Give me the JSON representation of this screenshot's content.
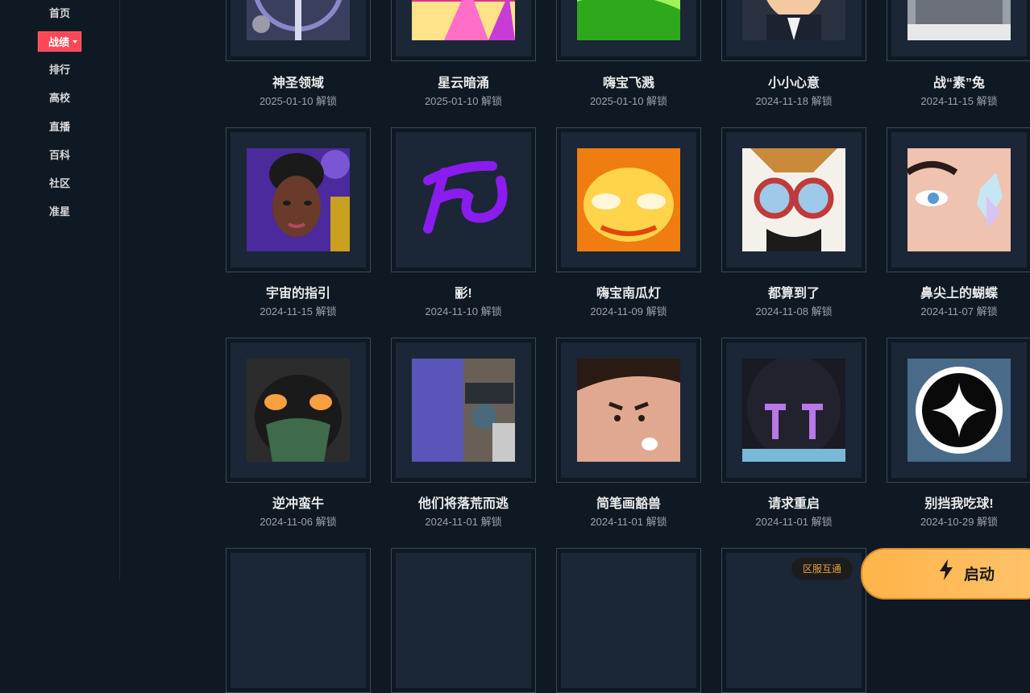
{
  "sidebar": {
    "items": [
      {
        "label": "首页"
      },
      {
        "label": "战绩",
        "active": true
      },
      {
        "label": "排行"
      },
      {
        "label": "高校"
      },
      {
        "label": "直播"
      },
      {
        "label": "百科"
      },
      {
        "label": "社区"
      },
      {
        "label": "准星"
      }
    ]
  },
  "cards": [
    {
      "title": "神圣领域",
      "date": "2025-01-10 解锁",
      "icon": "sacred-domain-art"
    },
    {
      "title": "星云暗涌",
      "date": "2025-01-10 解锁",
      "icon": "nebula-art"
    },
    {
      "title": "嗨宝飞溅",
      "date": "2025-01-10 解锁",
      "icon": "splash-art"
    },
    {
      "title": "小小心意",
      "date": "2024-11-18 解锁",
      "icon": "gentleman-art"
    },
    {
      "title": "战“素”兔",
      "date": "2024-11-15 解锁",
      "icon": "pixel-rabbit-art"
    },
    {
      "title": "宇宙的指引",
      "date": "2024-11-15 解锁",
      "icon": "astra-portrait-art"
    },
    {
      "title": "彨!",
      "date": "2024-11-10 解锁",
      "icon": "purple-calligraphy-art"
    },
    {
      "title": "嗨宝南瓜灯",
      "date": "2024-11-09 解锁",
      "icon": "pumpkin-lantern-art"
    },
    {
      "title": "都算到了",
      "date": "2024-11-08 解锁",
      "icon": "goggles-cat-art"
    },
    {
      "title": "鼻尖上的蝴蝶",
      "date": "2024-11-07 解锁",
      "icon": "butterfly-nose-art"
    },
    {
      "title": "逆冲蛮牛",
      "date": "2024-11-06 解锁",
      "icon": "masked-bull-art"
    },
    {
      "title": "他们将落荒而逃",
      "date": "2024-11-01 解锁",
      "icon": "sniper-art"
    },
    {
      "title": "简笔画豁兽",
      "date": "2024-11-01 解锁",
      "icon": "doodle-face-art"
    },
    {
      "title": "请求重启",
      "date": "2024-11-01 解锁",
      "icon": "robot-helmet-art"
    },
    {
      "title": "别挡我吃球!",
      "date": "2024-10-29 解锁",
      "icon": "star-orb-art"
    }
  ],
  "footer": {
    "region_label": "区服互通",
    "start_label": "启动"
  },
  "colors": {
    "background": "#0f1923",
    "accent": "#ff4655",
    "start_button": "#ffb34a"
  }
}
